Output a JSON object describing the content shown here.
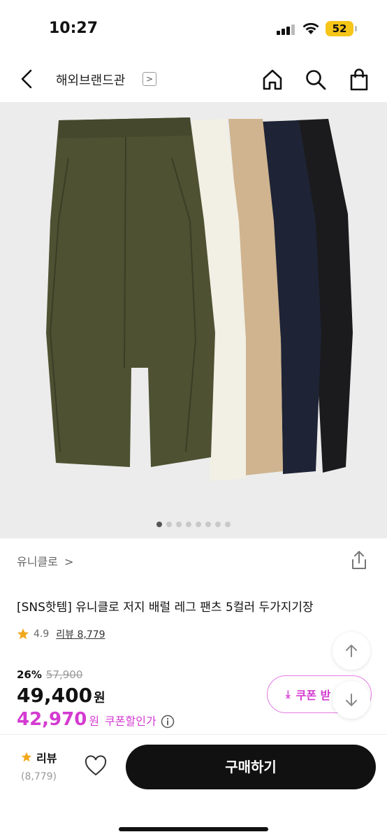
{
  "status_bar": {
    "time": "10:27",
    "battery": "52",
    "icons": [
      "signal-icon",
      "wifi-icon",
      "battery-icon"
    ]
  },
  "nav": {
    "title": "해외브랜드관",
    "title_arrow": ">",
    "icons": [
      "back-icon",
      "home-icon",
      "search-icon",
      "shopping-bag-icon"
    ]
  },
  "product_image": {
    "colors": [
      "#4e5132",
      "#f2efe4",
      "#cfb48f",
      "#1e2335",
      "#1b1b1d"
    ],
    "dots_total": 8,
    "dots_active": 1
  },
  "brand": {
    "name": "유니클로",
    "arrow": ">"
  },
  "product": {
    "title": "[SNS핫템] 유니클로 저지 배럴 레그 팬츠 5컬러 두가지기장",
    "rating": "4.9",
    "review_label": "리뷰 8,779"
  },
  "pricing": {
    "discount_rate": "26%",
    "original_price": "57,900",
    "price": "49,400",
    "price_unit": "원",
    "coupon_price": "42,970",
    "coupon_price_unit": "원",
    "coupon_label": "쿠폰할인가",
    "coupon_button_label": "쿠폰 받"
  },
  "bottom_bar": {
    "review_label": "리뷰",
    "review_count": "(8,779)",
    "buy_label": "구매하기"
  },
  "colors": {
    "accent": "#d43bd1",
    "star": "#f2a81d",
    "buy_button": "#111111"
  }
}
